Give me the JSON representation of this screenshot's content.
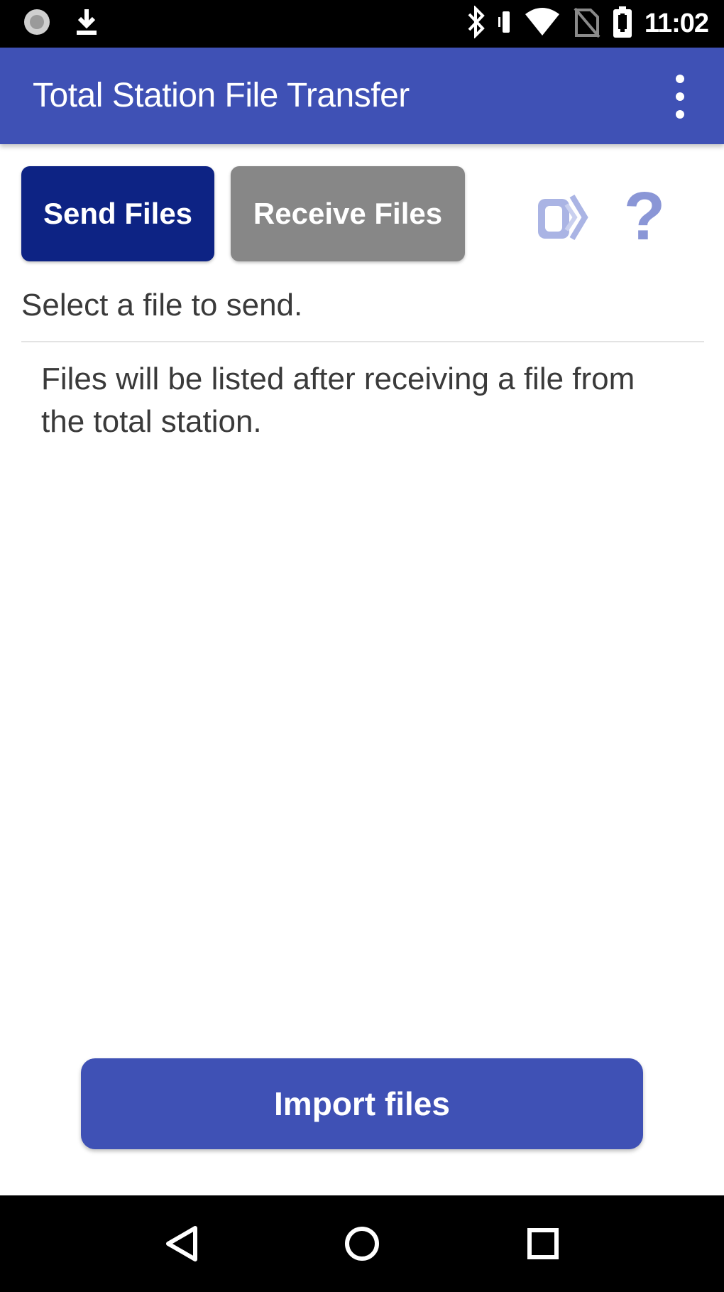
{
  "status_bar": {
    "time": "11:02",
    "left_icons": [
      "notification-dot-icon",
      "download-icon"
    ],
    "right_icons": [
      "bluetooth-icon",
      "vibrate-icon",
      "wifi-icon",
      "no-sim-icon",
      "battery-icon"
    ]
  },
  "app_bar": {
    "title": "Total Station File Transfer",
    "overflow_icon": "more-vert-icon"
  },
  "tabs": {
    "send_label": "Send Files",
    "receive_label": "Receive Files"
  },
  "toolbar_icons": [
    "transfer-icon",
    "help-icon"
  ],
  "help_glyph": "?",
  "content": {
    "select_label": "Select a file to send.",
    "empty_message": "Files will be listed after receiving a file from the total station."
  },
  "import_button": {
    "label": "Import files"
  },
  "nav_bar": {
    "icons": [
      "back-icon",
      "home-icon",
      "recents-icon"
    ]
  },
  "colors": {
    "primary": "#3f51b5",
    "send_tab": "#0d2384",
    "receive_tab": "#878787",
    "accent_icon": "#8a96d6"
  }
}
